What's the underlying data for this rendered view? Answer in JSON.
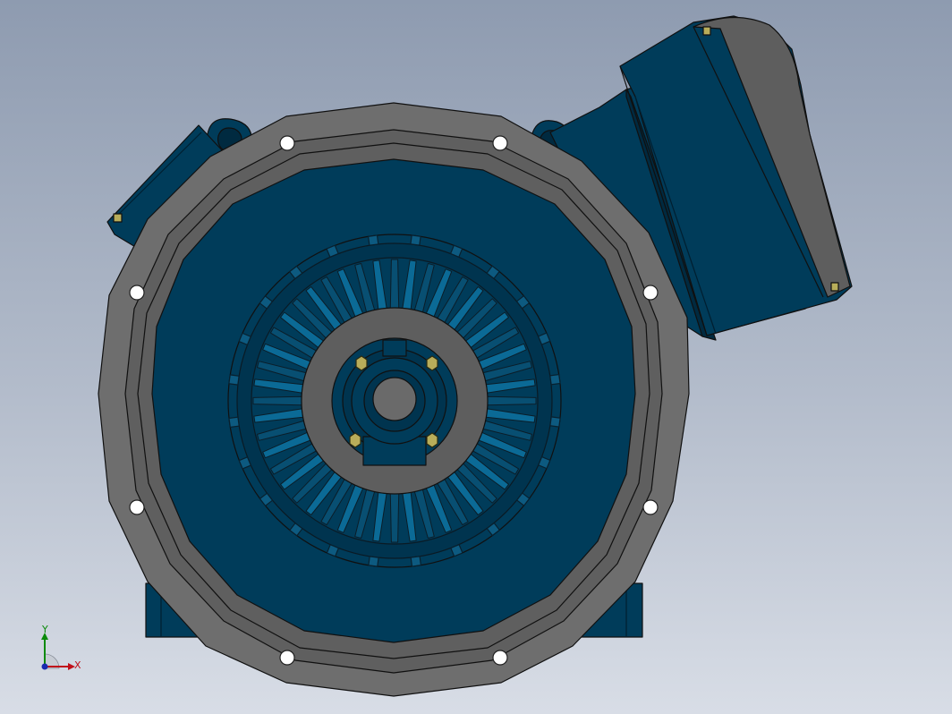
{
  "triad": {
    "x_label": "X",
    "y_label": "Y"
  },
  "colors": {
    "housing": "#003c5a",
    "housing_dark": "#002a40",
    "flange": "#6e6e6e",
    "flange_dark": "#5a5a5a",
    "edge": "#101010",
    "bolt": "#b8ad5a"
  },
  "icons": {
    "triad": "coordinate-axis-triad-icon"
  }
}
